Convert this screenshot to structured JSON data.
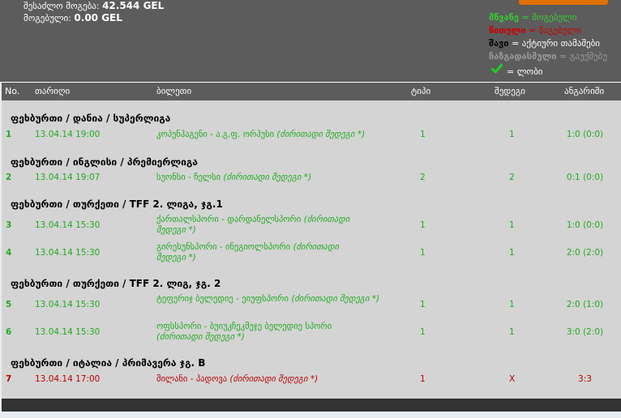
{
  "summary": {
    "possible_label": "შესაძლო მოგება:",
    "possible_value": "42.544 GEL",
    "won_label": "მოგებული:",
    "won_value": "0.00 GEL"
  },
  "legend": {
    "green_key": "მწვანე",
    "green_val": "= მოგებული",
    "red_key": "წითელი",
    "red_val": "= წაგებული",
    "black_key": "შავი",
    "black_val": "= აქტიური თამაშები",
    "grey_key": "ჩაზგადასმული",
    "grey_val": "= გაუქმებუ",
    "check_val": "= ლობი"
  },
  "header": {
    "no": "No.",
    "date": "თარიღი",
    "ticket": "ბილეთი",
    "type": "ტიპი",
    "result": "შედეგი",
    "score": "ანგარიში"
  },
  "leagues": [
    "ფეხბურთი / დანია / სუპერლიგა",
    "ფეხბურთი / ინგლისი / პრემიერლიგა",
    "ფეხბურთი / თურქეთი / TFF 2. ლიგა, ჯგ.1",
    "ფეხბურთი / თურქეთი / TFF 2. ლიგ, ჯგ. 2",
    "ფეხბურთი / იტალია / პრიმავერა ჯგ. B"
  ],
  "rows": [
    {
      "no": "1",
      "date": "13.04.14 19:00",
      "match": "კოპენჰაგენი - ა.გ.ფ. ორჰუსი",
      "kind": "(ძირითადი შედეგი *)",
      "type": "1",
      "result": "1",
      "score": "1:0 (0:0)",
      "color": "green"
    },
    {
      "no": "2",
      "date": "13.04.14 19:07",
      "match": "სუონსი - ჩელსი",
      "kind": "(ძირითადი შედეგი *)",
      "type": "2",
      "result": "2",
      "score": "0:1 (0:0)",
      "color": "green"
    },
    {
      "no": "3",
      "date": "13.04.14 15:30",
      "match": "ქართალსპორი - დარდანელსპორი",
      "kind": "(ძირითადი შედეგი *)",
      "type": "1",
      "result": "1",
      "score": "1:0 (0:0)",
      "color": "green"
    },
    {
      "no": "4",
      "date": "13.04.14 15:30",
      "match": "გირესუნსპორი - ინეგიოლსპორი",
      "kind": "(ძირითადი შედეგი *)",
      "type": "1",
      "result": "1",
      "score": "2:0 (2:0)",
      "color": "green"
    },
    {
      "no": "5",
      "date": "13.04.14 15:30",
      "match": "ტეფერიჯ ბელედიე - ეიუფსპორი",
      "kind": "(ძირითადი შედეგი *)",
      "type": "1",
      "result": "1",
      "score": "2:0 (1:0)",
      "color": "green"
    },
    {
      "no": "6",
      "date": "13.04.14 15:30",
      "match": "ოფსსპორი - ბუიუკჩეკმეჯე ბელედიე სპორი",
      "kind": "(ძირითადი შედეგი *)",
      "type": "1",
      "result": "1",
      "score": "3:0 (2:0)",
      "color": "green"
    },
    {
      "no": "7",
      "date": "13.04.14 17:00",
      "match": "მილანი - პადოვა",
      "kind": "(ძირითადი შედეგი *)",
      "type": "1",
      "result": "X",
      "score": "3:3",
      "color": "red"
    }
  ]
}
